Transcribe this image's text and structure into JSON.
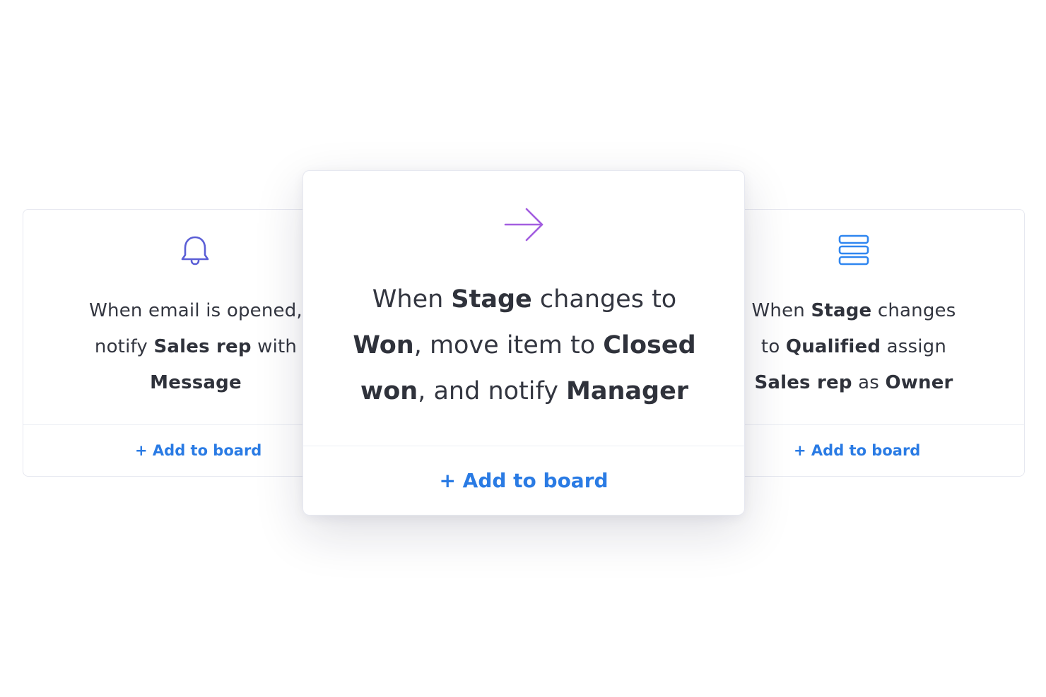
{
  "cards": [
    {
      "id": "left",
      "icon": "bell-icon",
      "icon_color": "#5b5fd6",
      "lines": [
        [
          {
            "t": "When email is opened,",
            "b": false
          }
        ],
        [
          {
            "t": "notify ",
            "b": false
          },
          {
            "t": "Sales rep",
            "b": true
          },
          {
            "t": " with",
            "b": false
          }
        ],
        [
          {
            "t": "Message",
            "b": true
          }
        ]
      ],
      "action_label": "+ Add to board"
    },
    {
      "id": "center",
      "icon": "arrow-right-icon",
      "icon_color": "#a35ee0",
      "lines": [
        [
          {
            "t": "When ",
            "b": false
          },
          {
            "t": "Stage",
            "b": true
          },
          {
            "t": " changes to",
            "b": false
          }
        ],
        [
          {
            "t": "Won",
            "b": true
          },
          {
            "t": ", move item to ",
            "b": false
          },
          {
            "t": "Closed",
            "b": true
          }
        ],
        [
          {
            "t": "won",
            "b": true
          },
          {
            "t": ", and notify ",
            "b": false
          },
          {
            "t": "Manager",
            "b": true
          }
        ]
      ],
      "action_label": "+ Add to board"
    },
    {
      "id": "right",
      "icon": "stack-icon",
      "icon_color": "#2f86f0",
      "lines": [
        [
          {
            "t": "When ",
            "b": false
          },
          {
            "t": "Stage",
            "b": true
          },
          {
            "t": " changes",
            "b": false
          }
        ],
        [
          {
            "t": "to ",
            "b": false
          },
          {
            "t": "Qualified",
            "b": true
          },
          {
            "t": " assign",
            "b": false
          }
        ],
        [
          {
            "t": "Sales rep",
            "b": true
          },
          {
            "t": " as ",
            "b": false
          },
          {
            "t": "Owner",
            "b": true
          }
        ]
      ],
      "action_label": "+ Add to board"
    }
  ],
  "colors": {
    "link": "#2a7be4",
    "text": "#333640",
    "border": "#e6e8f0"
  }
}
